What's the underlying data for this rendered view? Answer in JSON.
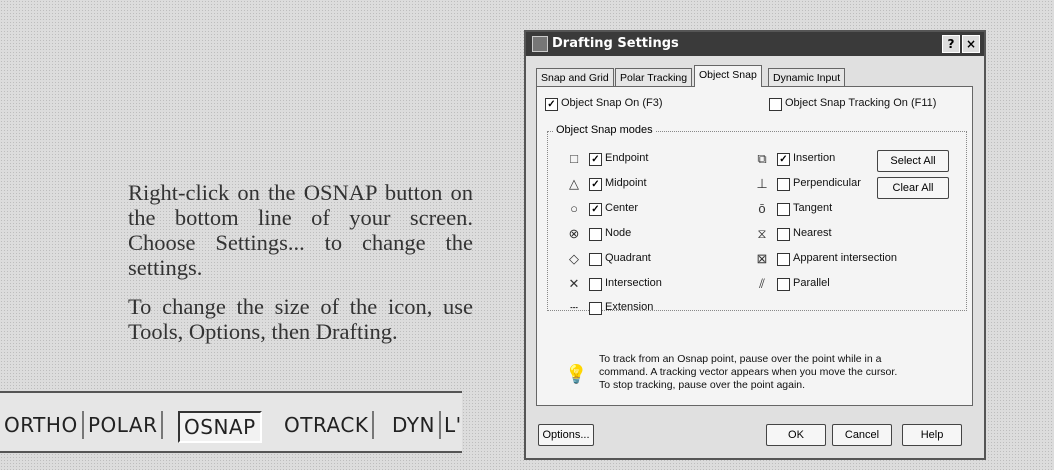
{
  "instructions": {
    "paragraph1": "Right-click on the OSNAP button on the bottom line of your screen. Choose Settings... to change the settings.",
    "paragraph2": "To change the size of the icon, use Tools, Options, then Drafting."
  },
  "statusbar": {
    "buttons": [
      "ORTHO",
      "POLAR",
      "OSNAP",
      "OTRACK",
      "DYN",
      "L'"
    ],
    "active": "OSNAP"
  },
  "dialog": {
    "title": "Drafting Settings",
    "help_button": "?",
    "close_button": "×",
    "tabs": [
      "Snap and Grid",
      "Polar Tracking",
      "Object Snap",
      "Dynamic Input"
    ],
    "active_tab": "Object Snap",
    "object_snap_on": {
      "label": "Object Snap On (F3)",
      "checked": true
    },
    "object_snap_tracking_on": {
      "label": "Object Snap Tracking On (F11)",
      "checked": false
    },
    "group_title": "Object Snap modes",
    "modes_left": [
      {
        "icon": "endpoint-marker",
        "label": "Endpoint",
        "checked": true
      },
      {
        "icon": "midpoint-marker",
        "label": "Midpoint",
        "checked": true
      },
      {
        "icon": "center-marker",
        "label": "Center",
        "checked": true
      },
      {
        "icon": "node-marker",
        "label": "Node",
        "checked": false
      },
      {
        "icon": "quadrant-marker",
        "label": "Quadrant",
        "checked": false
      },
      {
        "icon": "intersection-marker",
        "label": "Intersection",
        "checked": false
      },
      {
        "icon": "extension-marker",
        "label": "Extension",
        "checked": false
      }
    ],
    "modes_right": [
      {
        "icon": "insertion-marker",
        "label": "Insertion",
        "checked": true
      },
      {
        "icon": "perpendicular-marker",
        "label": "Perpendicular",
        "checked": false
      },
      {
        "icon": "tangent-marker",
        "label": "Tangent",
        "checked": false
      },
      {
        "icon": "nearest-marker",
        "label": "Nearest",
        "checked": false
      },
      {
        "icon": "apparent-intersection-marker",
        "label": "Apparent intersection",
        "checked": false
      },
      {
        "icon": "parallel-marker",
        "label": "Parallel",
        "checked": false
      }
    ],
    "select_all": "Select All",
    "clear_all": "Clear All",
    "info_lines": [
      "To track from an Osnap point, pause over the point while in a",
      "command.  A tracking vector appears when you move the cursor.",
      "To stop tracking, pause over the point again."
    ],
    "buttons": {
      "options": "Options...",
      "ok": "OK",
      "cancel": "Cancel",
      "help": "Help"
    }
  }
}
